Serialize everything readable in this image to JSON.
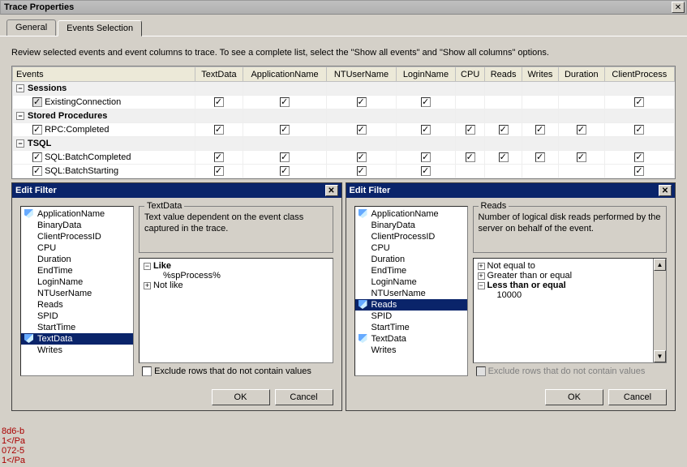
{
  "window": {
    "title": "Trace Properties"
  },
  "tabs": {
    "general": "General",
    "events": "Events Selection"
  },
  "instruction": "Review selected events and event columns to trace. To see a complete list, select the \"Show all events\" and \"Show all columns\" options.",
  "grid": {
    "headers": [
      "Events",
      "TextData",
      "ApplicationName",
      "NTUserName",
      "LoginName",
      "CPU",
      "Reads",
      "Writes",
      "Duration",
      "ClientProcess"
    ],
    "cat1": "Sessions",
    "ev1": "ExistingConnection",
    "cat2": "Stored Procedures",
    "ev2": "RPC:Completed",
    "cat3": "TSQL",
    "ev3": "SQL:BatchCompleted",
    "ev4": "SQL:BatchStarting"
  },
  "filter1": {
    "title": "Edit Filter",
    "items": [
      "ApplicationName",
      "BinaryData",
      "ClientProcessID",
      "CPU",
      "Duration",
      "EndTime",
      "LoginName",
      "NTUserName",
      "Reads",
      "SPID",
      "StartTime",
      "TextData",
      "Writes"
    ],
    "field_label": "TextData",
    "field_desc": "Text value dependent on the event class captured in the trace.",
    "tree": {
      "n1": "Like",
      "n1v": "%spProcess%",
      "n2": "Not like"
    },
    "exclude": "Exclude rows that do not contain values",
    "ok": "OK",
    "cancel": "Cancel"
  },
  "filter2": {
    "title": "Edit Filter",
    "items": [
      "ApplicationName",
      "BinaryData",
      "ClientProcessID",
      "CPU",
      "Duration",
      "EndTime",
      "LoginName",
      "NTUserName",
      "Reads",
      "SPID",
      "StartTime",
      "TextData",
      "Writes"
    ],
    "field_label": "Reads",
    "field_desc": "Number of logical disk reads performed by the server on behalf of the event.",
    "tree": {
      "n1": "Not equal to",
      "n2": "Greater than or equal",
      "n3": "Less than or equal",
      "n3v": "10000"
    },
    "exclude": "Exclude rows that do not contain values",
    "ok": "OK",
    "cancel": "Cancel"
  },
  "bg": {
    "l1": "8d6-b",
    "l2": "1</Pa",
    "l3": "072-5",
    "l4": "1</Pa"
  }
}
